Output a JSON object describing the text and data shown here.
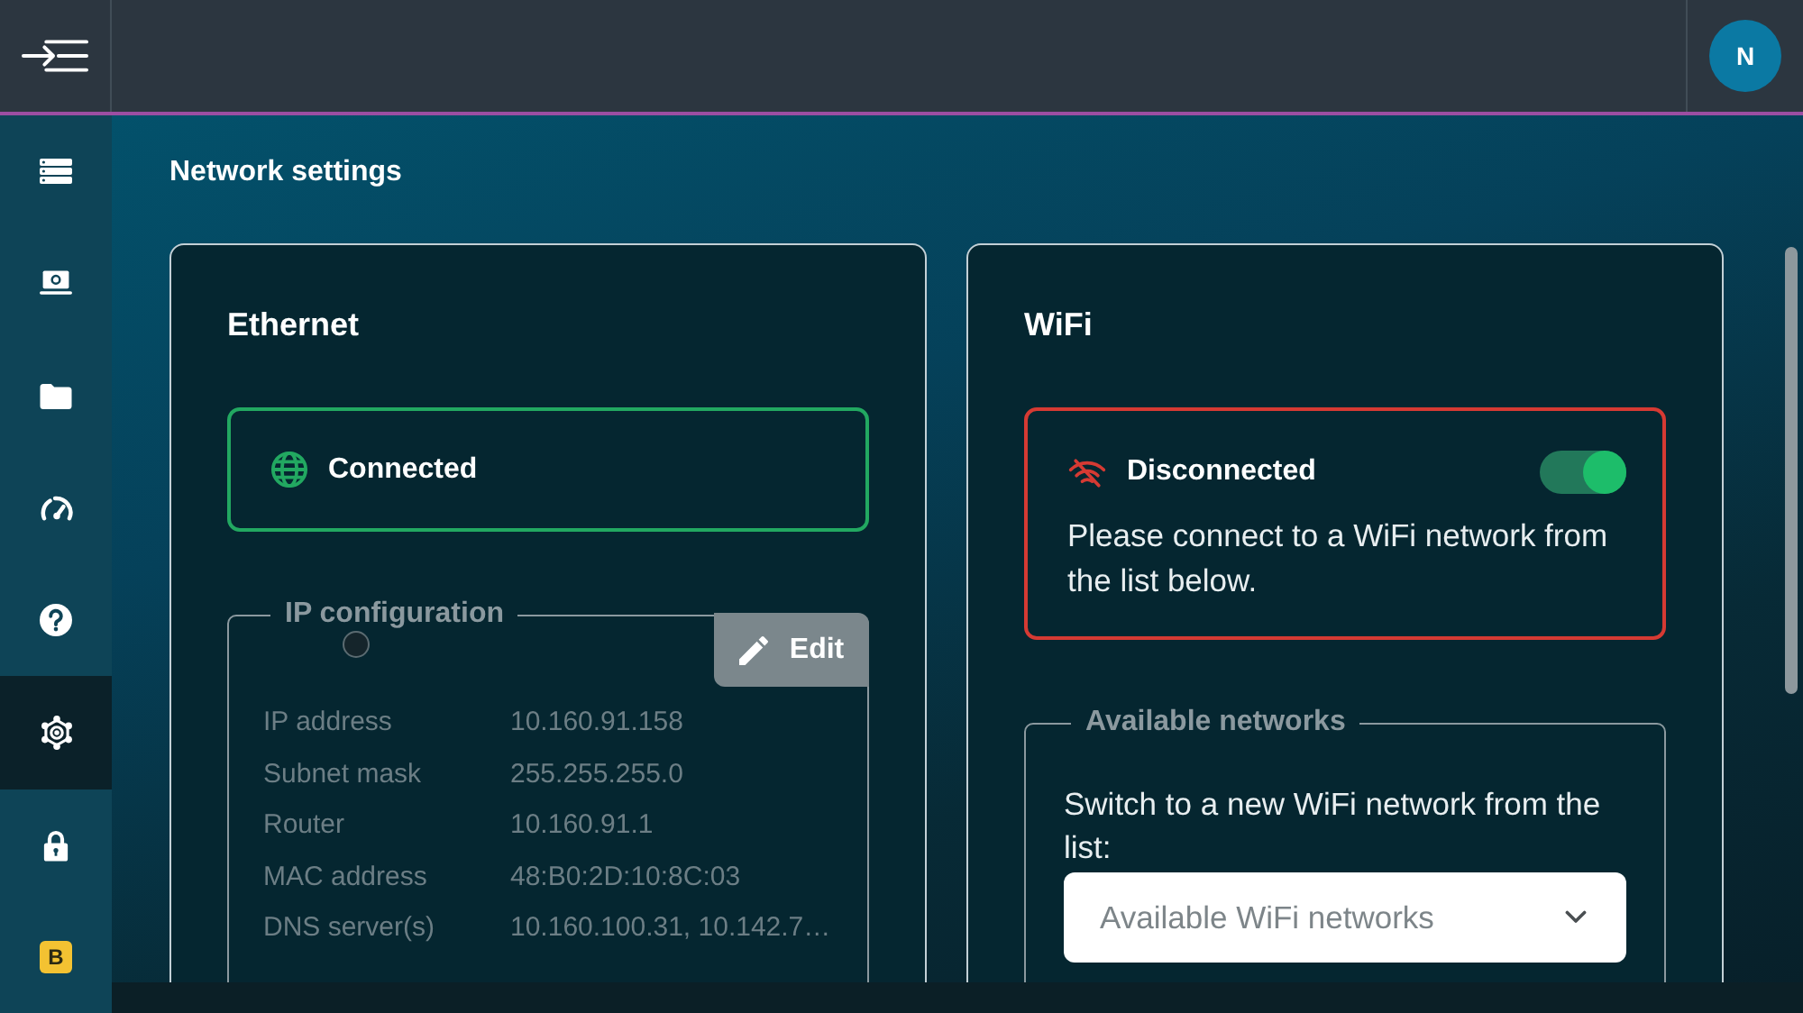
{
  "header": {
    "avatar": {
      "initial": "N"
    }
  },
  "sidebar": {
    "items": [
      {
        "kind": "list",
        "selected": false
      },
      {
        "kind": "laptop",
        "selected": false
      },
      {
        "kind": "folder",
        "selected": false
      },
      {
        "kind": "gauge",
        "selected": false
      },
      {
        "kind": "help",
        "selected": false
      },
      {
        "kind": "settings",
        "selected": true
      },
      {
        "kind": "lock",
        "selected": false
      },
      {
        "kind": "badge",
        "label": "B",
        "selected": false
      }
    ]
  },
  "page": {
    "title": "Network settings"
  },
  "ethernet": {
    "title": "Ethernet",
    "status": {
      "kind": "connected",
      "label": "Connected"
    },
    "ip_configuration": {
      "legend": "IP configuration",
      "disabled": true,
      "edit_button": "Edit",
      "rows": [
        {
          "label": "IP address",
          "value": "10.160.91.158"
        },
        {
          "label": "Subnet mask",
          "value": "255.255.255.0"
        },
        {
          "label": "Router",
          "value": "10.160.91.1"
        },
        {
          "label": "MAC address",
          "value": "48:B0:2D:10:8C:03"
        },
        {
          "label": "DNS server(s)",
          "value": "10.160.100.31, 10.142.7…"
        }
      ]
    }
  },
  "wifi": {
    "title": "WiFi",
    "status": {
      "kind": "disconnected",
      "label": "Disconnected",
      "message": "Please connect to a WiFi network from the list below.",
      "toggle": {
        "on": true
      }
    },
    "available_networks": {
      "legend": "Available networks",
      "instruction": "Switch to a new WiFi network from the list:",
      "select": {
        "placeholder": "Available WiFi networks"
      }
    }
  }
}
